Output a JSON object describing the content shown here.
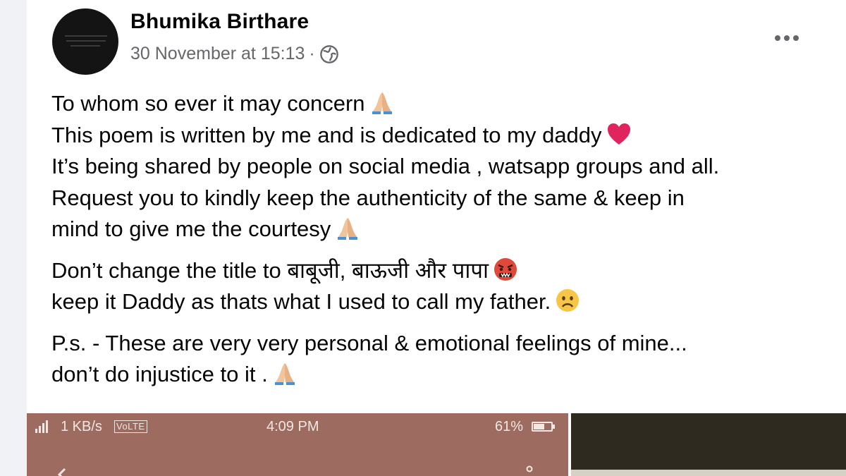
{
  "post": {
    "author": "Bhumika Birthare",
    "timestamp": "30 November at 15:13",
    "separator": "·",
    "audience_icon": "globe-icon",
    "menu_icon": "more-options-icon",
    "paragraphs": [
      {
        "lines": [
          {
            "text": "To whom so ever it may concern",
            "emoji": "folded-hands-emoji"
          },
          {
            "text": "This poem is written by me and is dedicated to my daddy",
            "emoji": "red-heart-emoji"
          },
          {
            "text": "It’s being shared by people on social media , watsapp groups and all.",
            "emoji": null
          },
          {
            "text": "Request you to kindly keep the authenticity of the same & keep in",
            "emoji": null
          },
          {
            "text": "mind to give me the courtesy",
            "emoji": "folded-hands-emoji"
          }
        ]
      },
      {
        "lines": [
          {
            "text": "Don’t change the title to बाबूजी, बाऊजी और पापा",
            "emoji": "angry-face-emoji"
          },
          {
            "text": "keep it Daddy as thats what I used to call my father.",
            "emoji": "worried-face-emoji"
          }
        ]
      },
      {
        "lines": [
          {
            "text": "P.s. - These are very very personal & emotional feelings of mine...",
            "emoji": null
          },
          {
            "text": "don’t do injustice to it .",
            "emoji": "folded-hands-emoji"
          }
        ]
      }
    ]
  },
  "attachment": {
    "status_bar": {
      "net_speed": "1 KB/s",
      "volte": "VoLTE",
      "time": "4:09 PM",
      "battery": "61%",
      "battery_level": 0.61
    }
  },
  "colors": {
    "name": "#050505",
    "meta": "#65676b",
    "photo_left_bg": "#9d6b5f",
    "photo_right_bg": "#2e2a1f",
    "heart": "#e0245e"
  }
}
